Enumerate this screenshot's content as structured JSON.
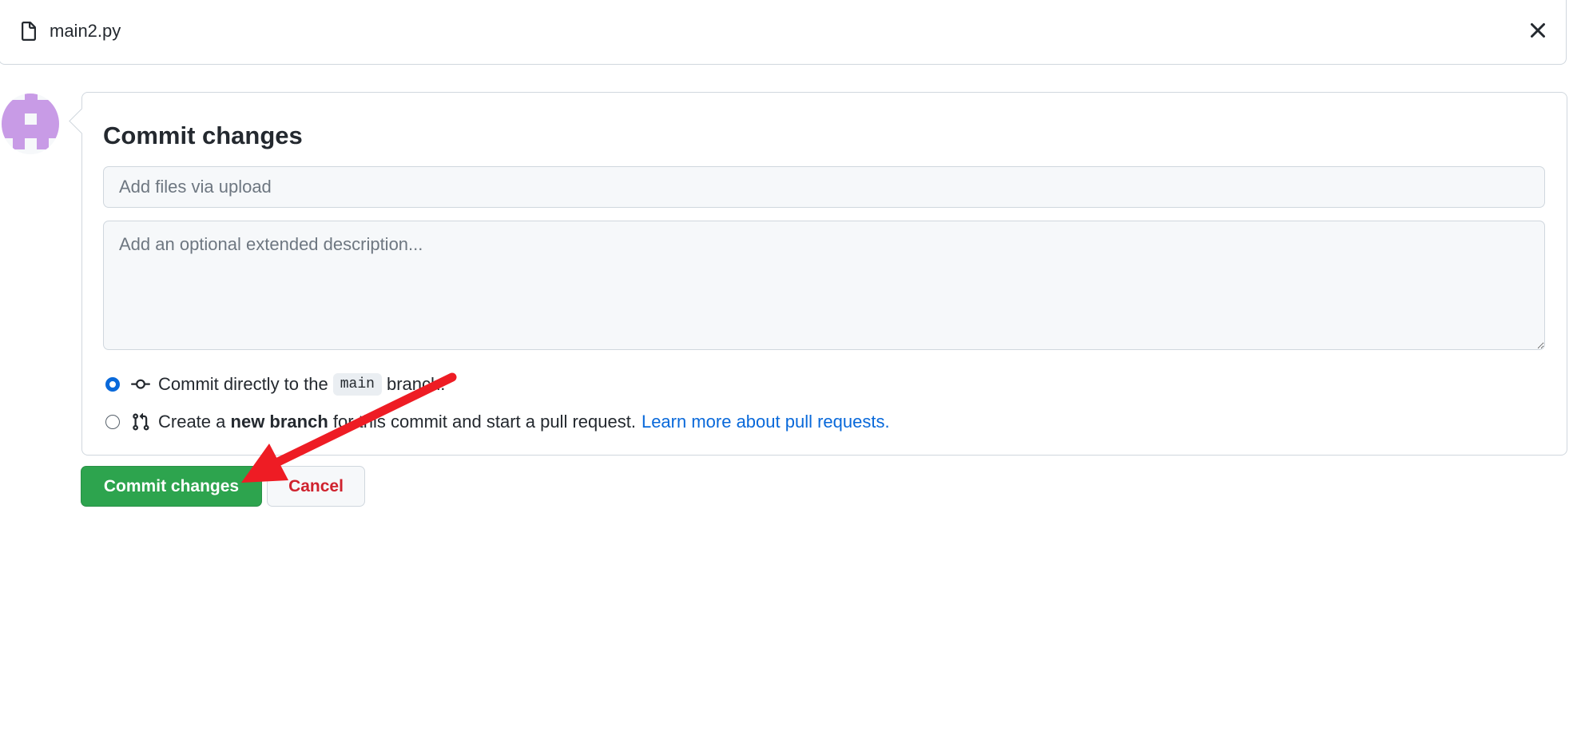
{
  "file": {
    "name": "main2.py",
    "file_icon": "file-icon",
    "close_icon": "x-icon"
  },
  "avatar": {
    "icon": "identicon-avatar",
    "color": "#c89be6"
  },
  "commit": {
    "title": "Commit changes",
    "summary_placeholder": "Add files via upload",
    "summary_value": "",
    "description_placeholder": "Add an optional extended description...",
    "description_value": "",
    "options": [
      {
        "icon": "git-commit-icon",
        "prefix": "Commit directly to the",
        "branch": "main",
        "suffix": "branch.",
        "selected": true
      },
      {
        "icon": "git-pull-request-icon",
        "prefix": "Create a",
        "bold": "new branch",
        "suffix": "for this commit and start a pull request.",
        "link": "Learn more about pull requests.",
        "selected": false
      }
    ]
  },
  "buttons": {
    "commit_label": "Commit changes",
    "cancel_label": "Cancel"
  },
  "colors": {
    "primary_button": "#2da44e",
    "cancel_text": "#cf222e",
    "link": "#0969da",
    "radio_selected": "#0969da",
    "annotation_arrow": "#ee1c24"
  }
}
